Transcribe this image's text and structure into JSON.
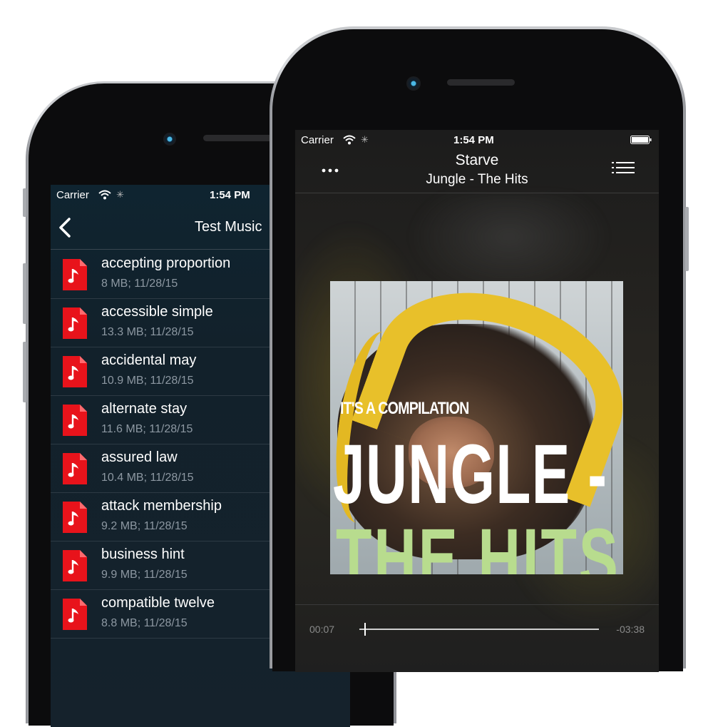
{
  "left_phone": {
    "status_bar": {
      "carrier": "Carrier",
      "time": "1:54 PM"
    },
    "nav": {
      "title": "Test Music"
    },
    "files": [
      {
        "name": "accepting proportion",
        "meta": "8 MB; 11/28/15"
      },
      {
        "name": "accessible simple",
        "meta": "13.3 MB; 11/28/15"
      },
      {
        "name": "accidental may",
        "meta": "10.9 MB; 11/28/15"
      },
      {
        "name": "alternate stay",
        "meta": "11.6 MB; 11/28/15"
      },
      {
        "name": "assured law",
        "meta": "10.4 MB; 11/28/15"
      },
      {
        "name": "attack membership",
        "meta": "9.2 MB; 11/28/15"
      },
      {
        "name": "business hint",
        "meta": "9.9 MB; 11/28/15"
      },
      {
        "name": "compatible twelve",
        "meta": "8.8 MB; 11/28/15"
      }
    ],
    "colors": {
      "file_icon": "#e8131b",
      "list_bg": "#12222c"
    }
  },
  "right_phone": {
    "status_bar": {
      "carrier": "Carrier",
      "time": "1:54 PM"
    },
    "nav": {
      "song_title": "Starve",
      "album_line": "Jungle - The Hits"
    },
    "artwork": {
      "tagline": "IT'S A COMPILATION",
      "headline1": "JUNGLE -",
      "headline2": "THE HITS"
    },
    "playback": {
      "elapsed": "00:07",
      "remaining": "-03:38",
      "progress": 0.02
    },
    "colors": {
      "accent_green": "#b8dc8e",
      "banana": "#e8c02a"
    }
  }
}
